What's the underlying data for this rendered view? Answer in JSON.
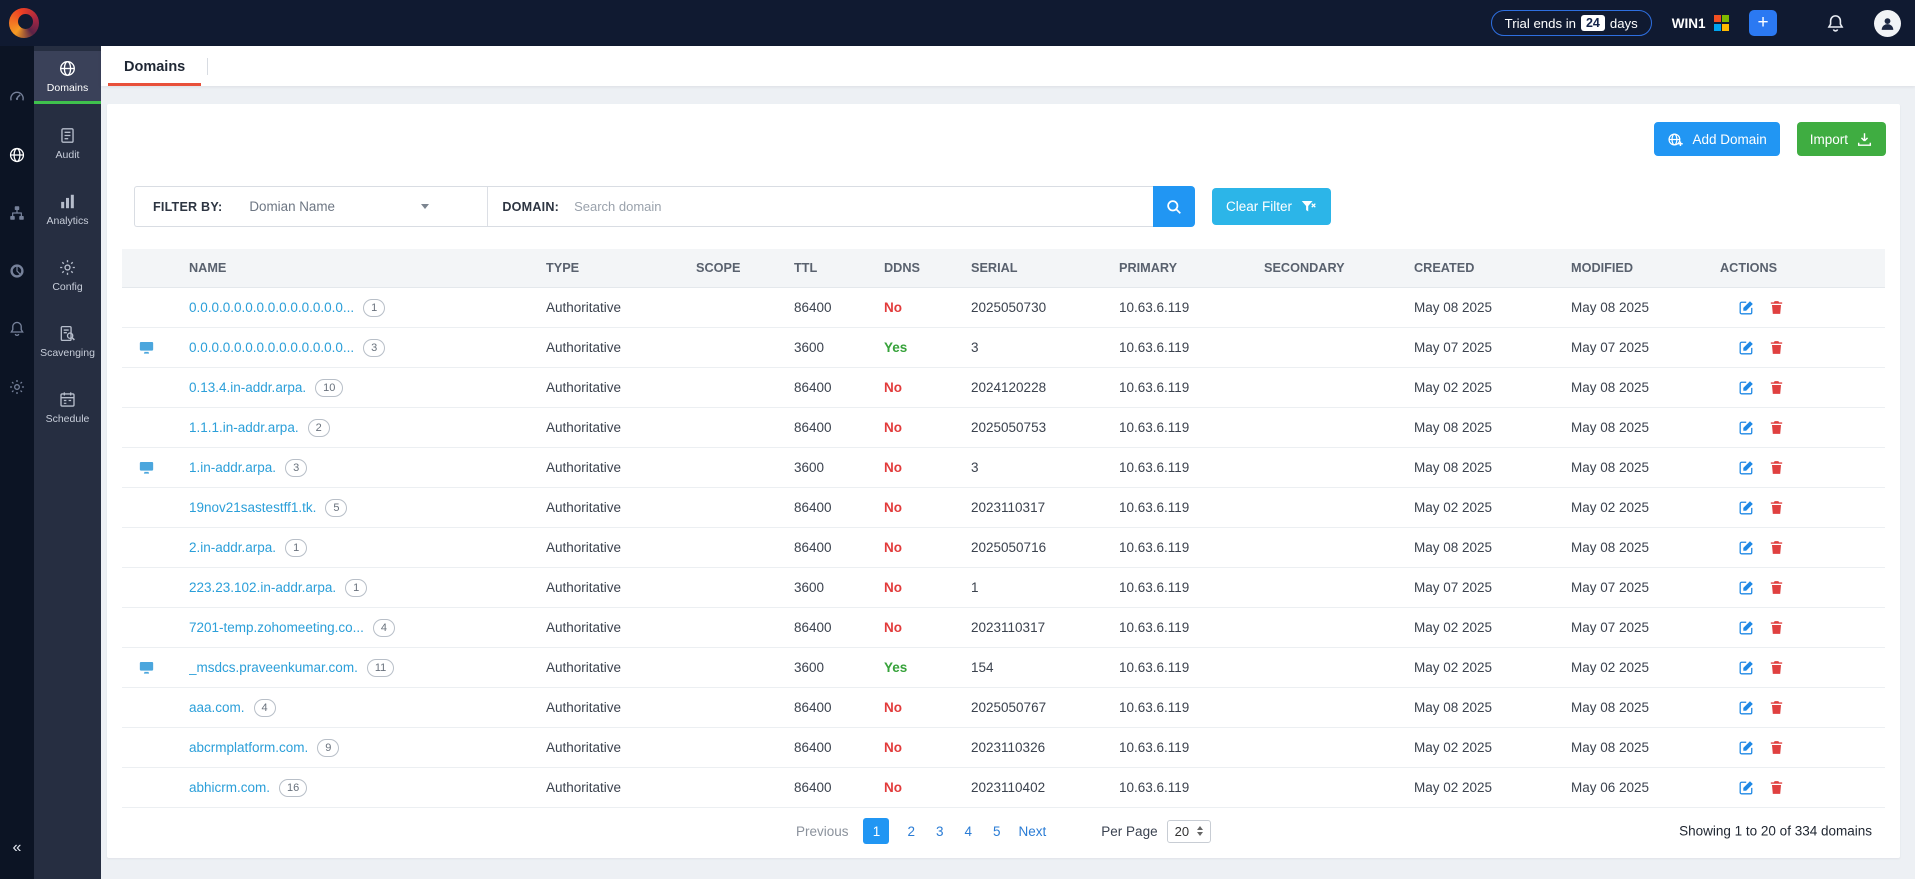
{
  "topbar": {
    "trial_prefix": "Trial ends in",
    "trial_highlight": "24",
    "trial_suffix": "days",
    "server_name": "WIN1",
    "quick_add_label": "+"
  },
  "sidebar": {
    "collapse_label": "«",
    "rail": [
      {
        "icon": "dashboard-icon",
        "active": false
      },
      {
        "icon": "dns-globe-icon",
        "active": true
      },
      {
        "icon": "sites-icon",
        "active": false
      },
      {
        "icon": "reports-icon",
        "active": false
      },
      {
        "icon": "alarms-icon",
        "active": false
      },
      {
        "icon": "admin-icon",
        "active": false
      }
    ],
    "items": [
      {
        "label": "Domains",
        "icon": "domains-icon",
        "active": true
      },
      {
        "label": "Audit",
        "icon": "audit-icon",
        "active": false
      },
      {
        "label": "Analytics",
        "icon": "analytics-icon",
        "active": false
      },
      {
        "label": "Config",
        "icon": "config-icon",
        "active": false
      },
      {
        "label": "Scavenging",
        "icon": "scavenging-icon",
        "active": false
      },
      {
        "label": "Schedule",
        "icon": "schedule-icon",
        "active": false
      }
    ]
  },
  "tabs": [
    {
      "label": "Domains",
      "active": true
    }
  ],
  "toolbar": {
    "add_domain_label": "Add Domain",
    "import_label": "Import"
  },
  "filter": {
    "filter_by_label": "FILTER BY:",
    "filter_by_value": "Domian Name",
    "domain_label": "DOMAIN:",
    "search_placeholder": "Search domain",
    "clear_filter_label": "Clear Filter"
  },
  "table": {
    "columns": [
      "NAME",
      "TYPE",
      "SCOPE",
      "TTL",
      "DDNS",
      "SERIAL",
      "PRIMARY",
      "SECONDARY",
      "CREATED",
      "MODIFIED",
      "ACTIONS"
    ],
    "rows": [
      {
        "ad": false,
        "name": "0.0.0.0.0.0.0.0.0.0.0.0.0.0...",
        "count": "1",
        "type": "Authoritative",
        "scope": "",
        "ttl": "86400",
        "ddns": "No",
        "serial": "2025050730",
        "primary": "10.63.6.119",
        "secondary": "",
        "created": "May 08 2025",
        "modified": "May 08 2025"
      },
      {
        "ad": true,
        "name": "0.0.0.0.0.0.0.0.0.0.0.0.0.0...",
        "count": "3",
        "type": "Authoritative",
        "scope": "",
        "ttl": "3600",
        "ddns": "Yes",
        "serial": "3",
        "primary": "10.63.6.119",
        "secondary": "",
        "created": "May 07 2025",
        "modified": "May 07 2025"
      },
      {
        "ad": false,
        "name": "0.13.4.in-addr.arpa.",
        "count": "10",
        "type": "Authoritative",
        "scope": "",
        "ttl": "86400",
        "ddns": "No",
        "serial": "2024120228",
        "primary": "10.63.6.119",
        "secondary": "",
        "created": "May 02 2025",
        "modified": "May 08 2025"
      },
      {
        "ad": false,
        "name": "1.1.1.in-addr.arpa.",
        "count": "2",
        "type": "Authoritative",
        "scope": "",
        "ttl": "86400",
        "ddns": "No",
        "serial": "2025050753",
        "primary": "10.63.6.119",
        "secondary": "",
        "created": "May 08 2025",
        "modified": "May 08 2025"
      },
      {
        "ad": true,
        "name": "1.in-addr.arpa.",
        "count": "3",
        "type": "Authoritative",
        "scope": "",
        "ttl": "3600",
        "ddns": "No",
        "serial": "3",
        "primary": "10.63.6.119",
        "secondary": "",
        "created": "May 08 2025",
        "modified": "May 08 2025"
      },
      {
        "ad": false,
        "name": "19nov21sastestff1.tk.",
        "count": "5",
        "type": "Authoritative",
        "scope": "",
        "ttl": "86400",
        "ddns": "No",
        "serial": "2023110317",
        "primary": "10.63.6.119",
        "secondary": "",
        "created": "May 02 2025",
        "modified": "May 02 2025"
      },
      {
        "ad": false,
        "name": "2.in-addr.arpa.",
        "count": "1",
        "type": "Authoritative",
        "scope": "",
        "ttl": "86400",
        "ddns": "No",
        "serial": "2025050716",
        "primary": "10.63.6.119",
        "secondary": "",
        "created": "May 08 2025",
        "modified": "May 08 2025"
      },
      {
        "ad": false,
        "name": "223.23.102.in-addr.arpa.",
        "count": "1",
        "type": "Authoritative",
        "scope": "",
        "ttl": "3600",
        "ddns": "No",
        "serial": "1",
        "primary": "10.63.6.119",
        "secondary": "",
        "created": "May 07 2025",
        "modified": "May 07 2025"
      },
      {
        "ad": false,
        "name": "7201-temp.zohomeeting.co...",
        "count": "4",
        "type": "Authoritative",
        "scope": "",
        "ttl": "86400",
        "ddns": "No",
        "serial": "2023110317",
        "primary": "10.63.6.119",
        "secondary": "",
        "created": "May 02 2025",
        "modified": "May 07 2025"
      },
      {
        "ad": true,
        "name": "_msdcs.praveenkumar.com.",
        "count": "11",
        "type": "Authoritative",
        "scope": "",
        "ttl": "3600",
        "ddns": "Yes",
        "serial": "154",
        "primary": "10.63.6.119",
        "secondary": "",
        "created": "May 02 2025",
        "modified": "May 02 2025"
      },
      {
        "ad": false,
        "name": "aaa.com.",
        "count": "4",
        "type": "Authoritative",
        "scope": "",
        "ttl": "86400",
        "ddns": "No",
        "serial": "2025050767",
        "primary": "10.63.6.119",
        "secondary": "",
        "created": "May 08 2025",
        "modified": "May 08 2025"
      },
      {
        "ad": false,
        "name": "abcrmplatform.com.",
        "count": "9",
        "type": "Authoritative",
        "scope": "",
        "ttl": "86400",
        "ddns": "No",
        "serial": "2023110326",
        "primary": "10.63.6.119",
        "secondary": "",
        "created": "May 02 2025",
        "modified": "May 08 2025"
      },
      {
        "ad": false,
        "name": "abhicrm.com.",
        "count": "16",
        "type": "Authoritative",
        "scope": "",
        "ttl": "86400",
        "ddns": "No",
        "serial": "2023110402",
        "primary": "10.63.6.119",
        "secondary": "",
        "created": "May 02 2025",
        "modified": "May 06 2025"
      }
    ]
  },
  "pagination": {
    "previous_label": "Previous",
    "pages": [
      "1",
      "2",
      "3",
      "4",
      "5"
    ],
    "active_page": "1",
    "next_label": "Next",
    "per_page_label": "Per Page",
    "per_page_value": "20",
    "summary": "Showing 1 to 20 of 334 domains"
  },
  "colors": {
    "accent_blue": "#2196f3",
    "accent_green": "#3fad41",
    "accent_sky": "#2cb5e8",
    "tab_underline": "#e8503a",
    "sidebar_active_underline": "#3fc24d",
    "link_blue": "#2b9fd9",
    "ddns_no": "#e23b3b",
    "ddns_yes": "#36a23a",
    "topbar_bg": "#101a31"
  }
}
